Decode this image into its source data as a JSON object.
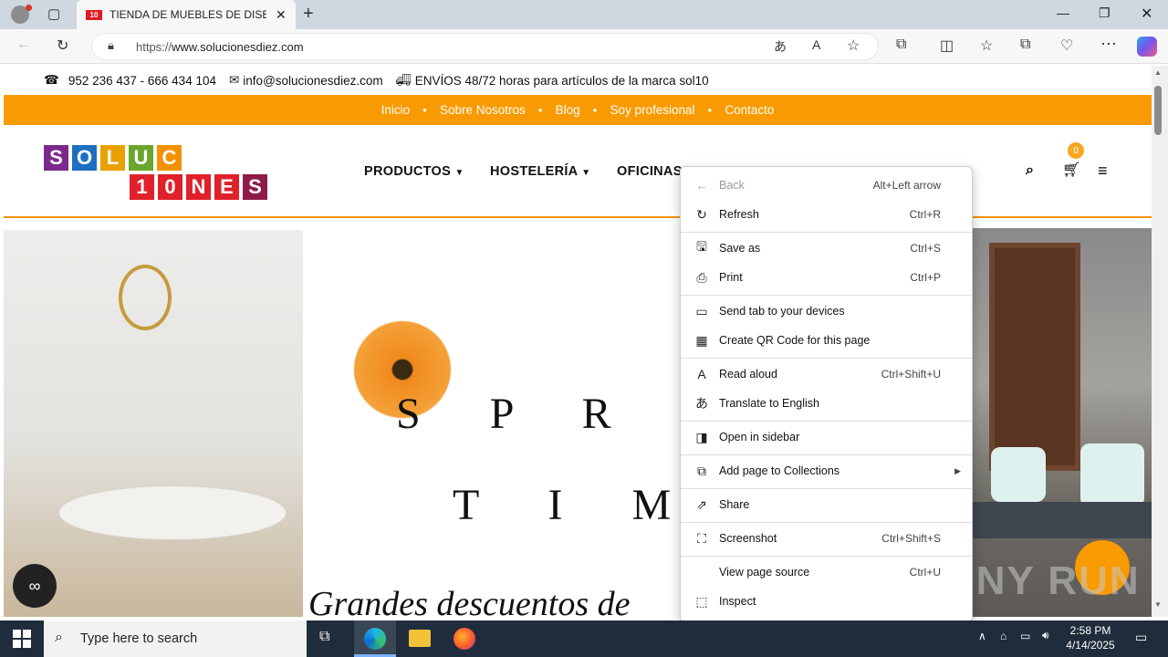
{
  "browser": {
    "tab_title": "TIENDA DE MUEBLES DE DISEÑO",
    "tab_favicon_text": "10",
    "url_prefix": "https://",
    "url_domain": "www.solucionesdiez.com"
  },
  "site": {
    "phone": "952 236 437 - 666 434 104",
    "email": "info@solucionesdiez.com",
    "shipping": "ENVÍOS 48/72 horas para artículos de la marca sol10",
    "top_nav": [
      "Inicio",
      "Sobre Nosotros",
      "Blog",
      "Soy profesional",
      "Contacto"
    ],
    "logo_row1": [
      "S",
      "O",
      "L",
      "U",
      "C"
    ],
    "logo_row2": [
      "1",
      "0",
      "N",
      "E",
      "S"
    ],
    "main_nav": [
      "PRODUCTOS",
      "HOSTELERÍA",
      "OFICINAS"
    ],
    "cart_count": "0",
    "hero_line1": "S P R I N",
    "hero_line2": "T I M E",
    "hero_script": "Grandes descuentos de"
  },
  "context_menu": {
    "items": [
      {
        "label": "Back",
        "shortcut": "Alt+Left arrow",
        "icon": "back-arrow-icon",
        "disabled": true
      },
      {
        "label": "Refresh",
        "shortcut": "Ctrl+R",
        "icon": "refresh-icon"
      },
      {
        "label": "Save as",
        "shortcut": "Ctrl+S",
        "icon": "save-icon"
      },
      {
        "label": "Print",
        "shortcut": "Ctrl+P",
        "icon": "print-icon"
      },
      {
        "label": "Send tab to your devices",
        "shortcut": "",
        "icon": "send-device-icon"
      },
      {
        "label": "Create QR Code for this page",
        "shortcut": "",
        "icon": "qr-code-icon"
      },
      {
        "label": "Read aloud",
        "shortcut": "Ctrl+Shift+U",
        "icon": "read-aloud-icon"
      },
      {
        "label": "Translate to English",
        "shortcut": "",
        "icon": "translate-icon"
      },
      {
        "label": "Open in sidebar",
        "shortcut": "",
        "icon": "sidebar-icon"
      },
      {
        "label": "Add page to Collections",
        "shortcut": "",
        "icon": "collections-icon"
      },
      {
        "label": "Share",
        "shortcut": "",
        "icon": "share-icon"
      },
      {
        "label": "Screenshot",
        "shortcut": "Ctrl+Shift+S",
        "icon": "screenshot-icon"
      },
      {
        "label": "View page source",
        "shortcut": "Ctrl+U",
        "icon": ""
      },
      {
        "label": "Inspect",
        "shortcut": "",
        "icon": "inspect-icon"
      }
    ]
  },
  "taskbar": {
    "search_placeholder": "Type here to search",
    "time": "2:58 PM",
    "date": "4/14/2025"
  },
  "watermark": "ANY RUN",
  "colors": {
    "orange": "#f99a00",
    "taskbar": "#1f2c3b",
    "logo_purple": "#7b2a8c",
    "logo_red": "#e0202a"
  }
}
